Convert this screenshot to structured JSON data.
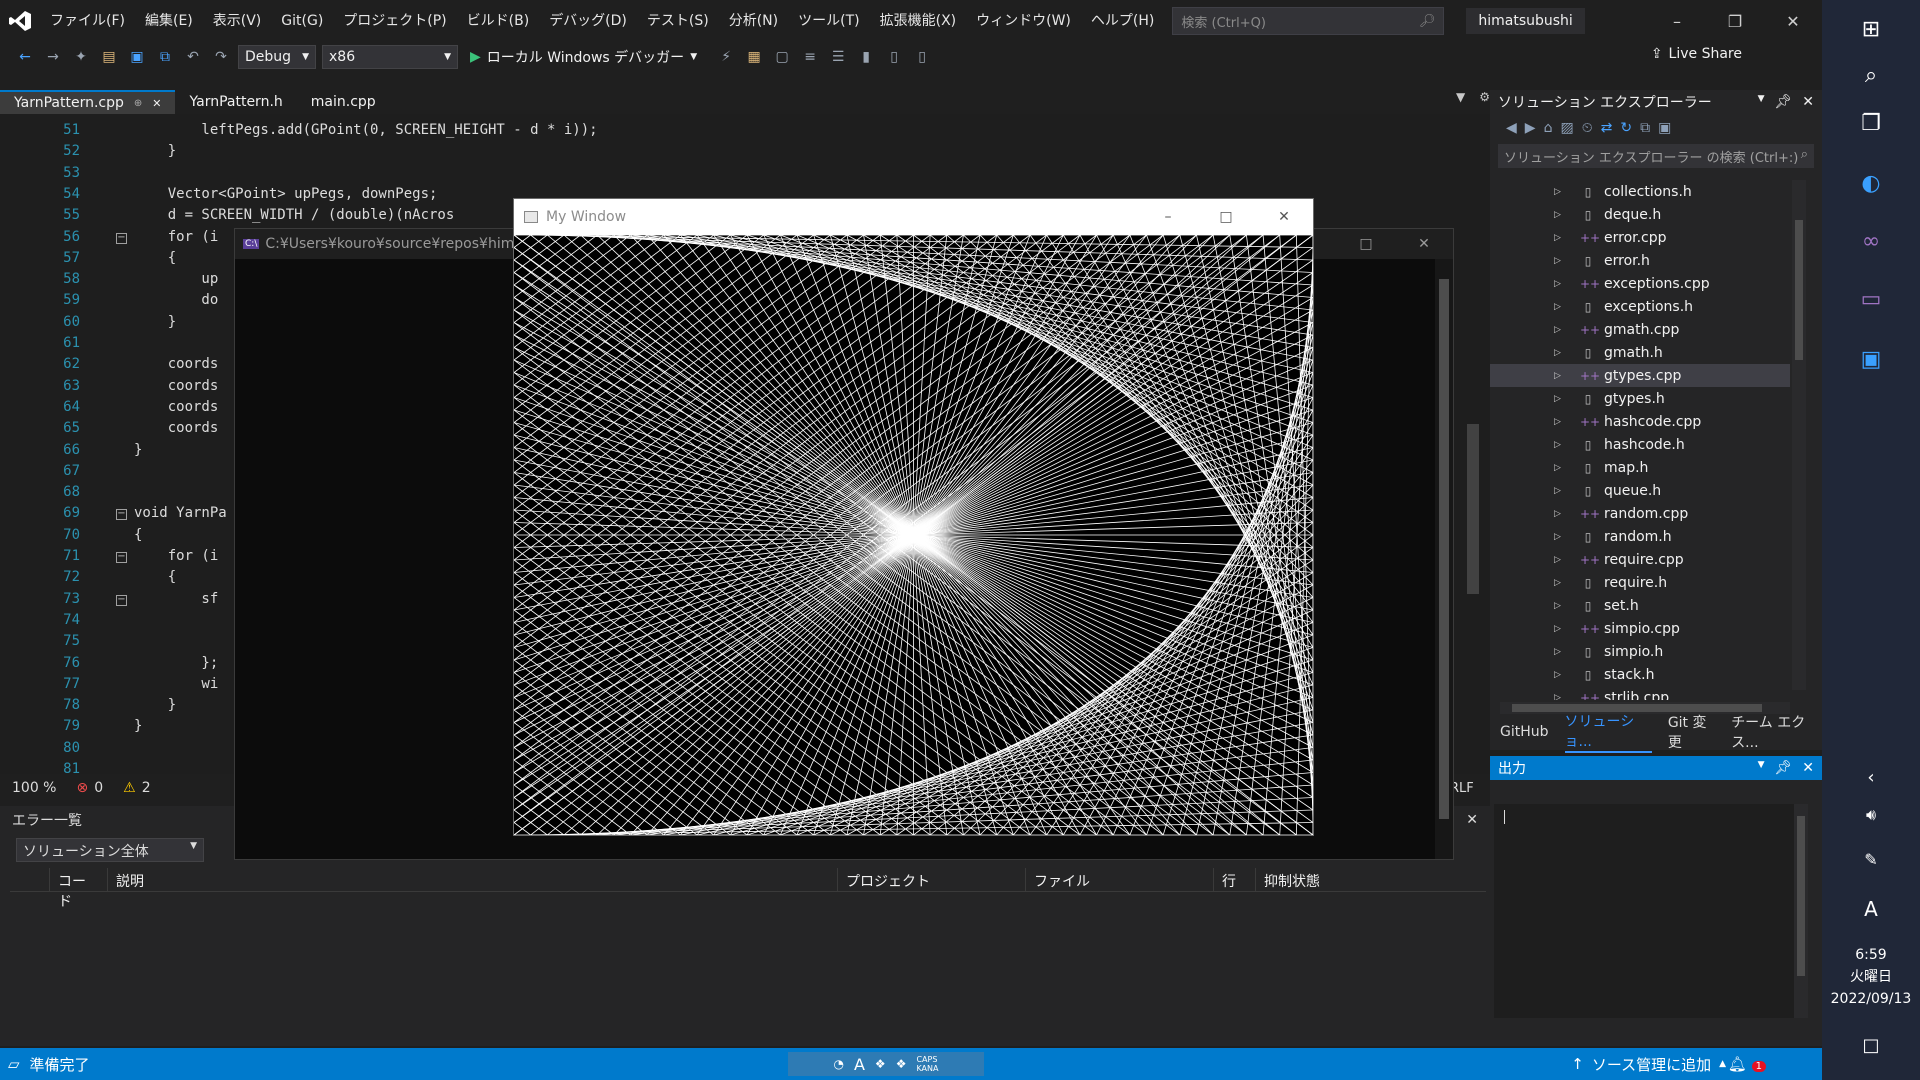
{
  "menubar": {
    "items": [
      "ファイル(F)",
      "編集(E)",
      "表示(V)",
      "Git(G)",
      "プロジェクト(P)",
      "ビルド(B)",
      "デバッグ(D)",
      "テスト(S)",
      "分析(N)",
      "ツール(T)",
      "拡張機能(X)",
      "ウィンドウ(W)",
      "ヘルプ(H)"
    ],
    "search_placeholder": "検索 (Ctrl+Q)",
    "account": "himatsubushi"
  },
  "toolbar": {
    "configuration": "Debug",
    "platform": "x86",
    "run_label": "ローカル Windows デバッガー",
    "live_share": "Live Share"
  },
  "tabs": [
    {
      "label": "YarnPattern.cpp",
      "active": true
    },
    {
      "label": "YarnPattern.h",
      "active": false
    },
    {
      "label": "main.cpp",
      "active": false
    }
  ],
  "editor": {
    "lines": [
      {
        "no": "51",
        "text": "        leftPegs.add(GPoint(0, SCREEN_HEIGHT - d * i));"
      },
      {
        "no": "52",
        "text": "    }"
      },
      {
        "no": "53",
        "text": ""
      },
      {
        "no": "54",
        "text": "    Vector<GPoint> upPegs, downPegs;"
      },
      {
        "no": "55",
        "text": "    d = SCREEN_WIDTH / (double)(nAcros"
      },
      {
        "no": "56",
        "text": "    for (i"
      },
      {
        "no": "57",
        "text": "    {"
      },
      {
        "no": "58",
        "text": "        up"
      },
      {
        "no": "59",
        "text": "        do"
      },
      {
        "no": "60",
        "text": "    }"
      },
      {
        "no": "61",
        "text": ""
      },
      {
        "no": "62",
        "text": "    coords"
      },
      {
        "no": "63",
        "text": "    coords"
      },
      {
        "no": "64",
        "text": "    coords"
      },
      {
        "no": "65",
        "text": "    coords"
      },
      {
        "no": "66",
        "text": "}"
      },
      {
        "no": "67",
        "text": ""
      },
      {
        "no": "68",
        "text": ""
      },
      {
        "no": "69",
        "text": "void YarnPa"
      },
      {
        "no": "70",
        "text": "{"
      },
      {
        "no": "71",
        "text": "    for (i"
      },
      {
        "no": "72",
        "text": "    {"
      },
      {
        "no": "73",
        "text": "        sf"
      },
      {
        "no": "74",
        "text": ""
      },
      {
        "no": "75",
        "text": ""
      },
      {
        "no": "76",
        "text": "        };"
      },
      {
        "no": "77",
        "text": "        wi"
      },
      {
        "no": "78",
        "text": "    }"
      },
      {
        "no": "79",
        "text": "}"
      },
      {
        "no": "80",
        "text": ""
      },
      {
        "no": "81",
        "text": ""
      }
    ],
    "zoom": "100 %",
    "errors": "0",
    "warnings": "2",
    "line_ending": "RLF"
  },
  "error_list": {
    "title": "エラー一覧",
    "scope": "ソリューション全体",
    "columns": [
      "コード",
      "説明",
      "プロジェクト",
      "ファイル",
      "行",
      "抑制状態"
    ]
  },
  "solution_explorer": {
    "title": "ソリューション エクスプローラー",
    "search_placeholder": "ソリューション エクスプローラー の検索 (Ctrl+:)",
    "files": [
      {
        "name": "collections.h",
        "kind": "h"
      },
      {
        "name": "deque.h",
        "kind": "h"
      },
      {
        "name": "error.cpp",
        "kind": "cpp"
      },
      {
        "name": "error.h",
        "kind": "h"
      },
      {
        "name": "exceptions.cpp",
        "kind": "cpp"
      },
      {
        "name": "exceptions.h",
        "kind": "h"
      },
      {
        "name": "gmath.cpp",
        "kind": "cpp"
      },
      {
        "name": "gmath.h",
        "kind": "h"
      },
      {
        "name": "gtypes.cpp",
        "kind": "cpp",
        "selected": true
      },
      {
        "name": "gtypes.h",
        "kind": "h"
      },
      {
        "name": "hashcode.cpp",
        "kind": "cpp"
      },
      {
        "name": "hashcode.h",
        "kind": "h"
      },
      {
        "name": "map.h",
        "kind": "h"
      },
      {
        "name": "queue.h",
        "kind": "h"
      },
      {
        "name": "random.cpp",
        "kind": "cpp"
      },
      {
        "name": "random.h",
        "kind": "h"
      },
      {
        "name": "require.cpp",
        "kind": "cpp"
      },
      {
        "name": "require.h",
        "kind": "h"
      },
      {
        "name": "set.h",
        "kind": "h"
      },
      {
        "name": "simpio.cpp",
        "kind": "cpp"
      },
      {
        "name": "simpio.h",
        "kind": "h"
      },
      {
        "name": "stack.h",
        "kind": "h"
      },
      {
        "name": "strlib.cpp",
        "kind": "cpp"
      }
    ],
    "bottom_tabs": [
      "GitHub",
      "ソリューショ...",
      "Git 変更",
      "チーム エクス..."
    ]
  },
  "output": {
    "title": "出力"
  },
  "console_window": {
    "title": "C:¥Users¥kouro¥source¥repos¥himat"
  },
  "graphics_window": {
    "title": "My Window"
  },
  "statusbar": {
    "ready": "準備完了",
    "source_control": "ソース管理に追加",
    "ime_caps": "CAPS",
    "ime_kana": "KANA",
    "notifications": "1"
  },
  "taskbar": {
    "time": "6:59",
    "weekday": "火曜日",
    "date": "2022/09/13",
    "ime_mode": "A"
  },
  "colors": {
    "accent": "#007acc",
    "editor_bg": "#1e1e1e",
    "line_numbers": "#2b91af",
    "keyword": "#569cd6",
    "type": "#4ec9b0"
  },
  "pattern": {
    "pegs_per_side": 48,
    "line_color": "#ffffff",
    "background": "#000000"
  }
}
